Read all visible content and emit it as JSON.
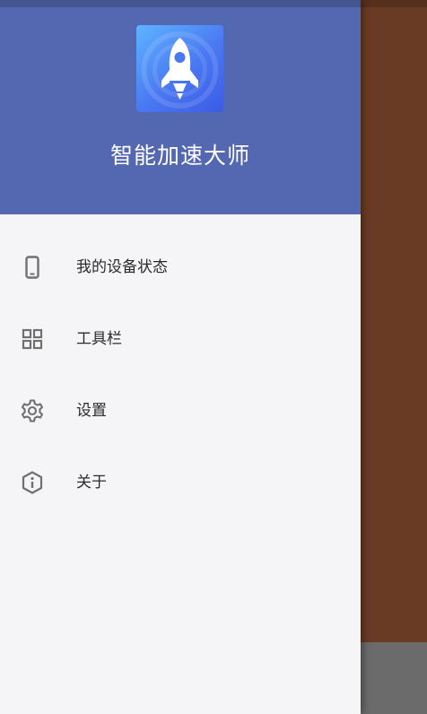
{
  "drawer": {
    "app_name": "智能加速大师",
    "logo_icon": "rocket-icon",
    "header_color": "#5368b0",
    "logo_gradient": [
      "#5fb4ff",
      "#3b5be6"
    ]
  },
  "menu": {
    "items": [
      {
        "label": "我的设备状态",
        "icon": "phone-icon"
      },
      {
        "label": "工具栏",
        "icon": "grid-icon"
      },
      {
        "label": "设置",
        "icon": "gear-icon"
      },
      {
        "label": "关于",
        "icon": "info-hexagon-icon"
      }
    ]
  },
  "background": {
    "app_color": "#6a3b24",
    "bottom_bar_color": "#6b6b6b"
  }
}
